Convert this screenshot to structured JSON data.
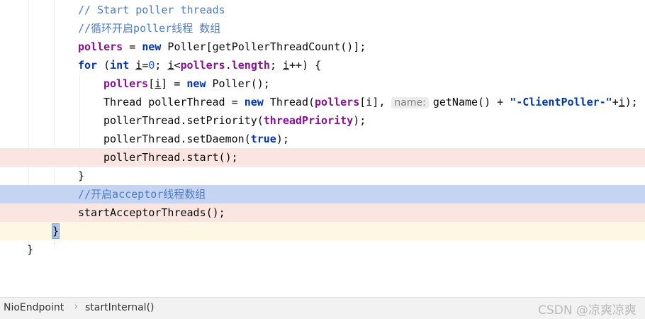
{
  "editor": {
    "lines": {
      "l1": {
        "text": "// Start poller threads"
      },
      "l2": {
        "text": "//循环开启poller线程 数组"
      },
      "l3": {
        "a": "pollers",
        "b": " = ",
        "c": "new",
        "d": " Poller[getPollerThreadCount()];"
      },
      "l4": {
        "a": "for",
        "b": " (",
        "c": "int",
        "d": " ",
        "e": "i",
        "f": "=",
        "g": "0",
        "h": "; ",
        "i": "i",
        "j": "<",
        "k": "pollers",
        "l": ".",
        "m": "length",
        "n": "; ",
        "o": "i",
        "p": "++) {"
      },
      "l5": {
        "a": "pollers",
        "b": "[",
        "c": "i",
        "d": "] = ",
        "e": "new",
        "f": " Poller();"
      },
      "l6": {
        "a": "Thread pollerThread = ",
        "b": "new",
        "c": " Thread(",
        "d": "pollers",
        "e": "[i], ",
        "hint": "name:",
        "f": "getName() + ",
        "g": "\"-ClientPoller-\"",
        "h": "+",
        "i": "i",
        "j": ");"
      },
      "l7": {
        "a": "pollerThread.setPriority(",
        "b": "threadPriority",
        "c": ");"
      },
      "l8": {
        "a": "pollerThread.setDaemon(",
        "b": "true",
        "c": ");"
      },
      "l9": {
        "text": "pollerThread.start();"
      },
      "l10": {
        "text": "}"
      },
      "l11": {
        "text": "//开启acceptor线程数组"
      },
      "l12": {
        "text": "startAcceptorThreads();"
      },
      "l13": {
        "text": "}"
      },
      "l14": {
        "text": "}"
      }
    }
  },
  "statusbar": {
    "crumb1": "NioEndpoint",
    "separator": "›",
    "crumb2": "startInternal()"
  },
  "watermark": "CSDN @凉爽凉爽"
}
